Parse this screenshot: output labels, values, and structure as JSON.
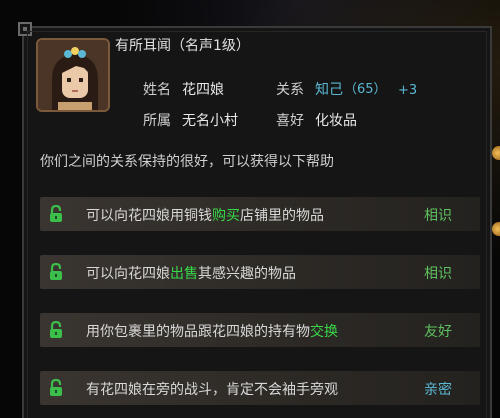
{
  "header": {
    "title": "有所耳闻（名声1级）"
  },
  "profile": {
    "name_label": "姓名",
    "name_value": "花四娘",
    "relation_label": "关系",
    "relation_value": "知己",
    "relation_points": "（65）",
    "relation_bonus": "+3",
    "affiliation_label": "所属",
    "affiliation_value": "无名小村",
    "hobby_label": "喜好",
    "hobby_value": "化妆品"
  },
  "description": "你们之间的关系保持的很好，可以获得以下帮助",
  "benefits": [
    {
      "pre": "可以向花四娘用铜钱",
      "highlight": "购买",
      "post": "店铺里的物品",
      "tier": "相识",
      "icon": "padlock-icon"
    },
    {
      "pre": "可以向花四娘",
      "highlight": "出售",
      "post": "其感兴趣的物品",
      "tier": "相识",
      "icon": "padlock-icon"
    },
    {
      "pre": "用你包裹里的物品跟花四娘的持有物",
      "highlight": "交换",
      "post": "",
      "tier": "友好",
      "icon": "padlock-icon"
    },
    {
      "pre": "有花四娘在旁的战斗，肯定不会袖手旁观",
      "highlight": "",
      "post": "",
      "tier": "亲密",
      "icon": "padlock-icon"
    }
  ],
  "colors": {
    "highlight": "#38d84a",
    "tier": "#5fc05f",
    "relation": "#5bb8d4",
    "row_bg": "#3a3530"
  }
}
